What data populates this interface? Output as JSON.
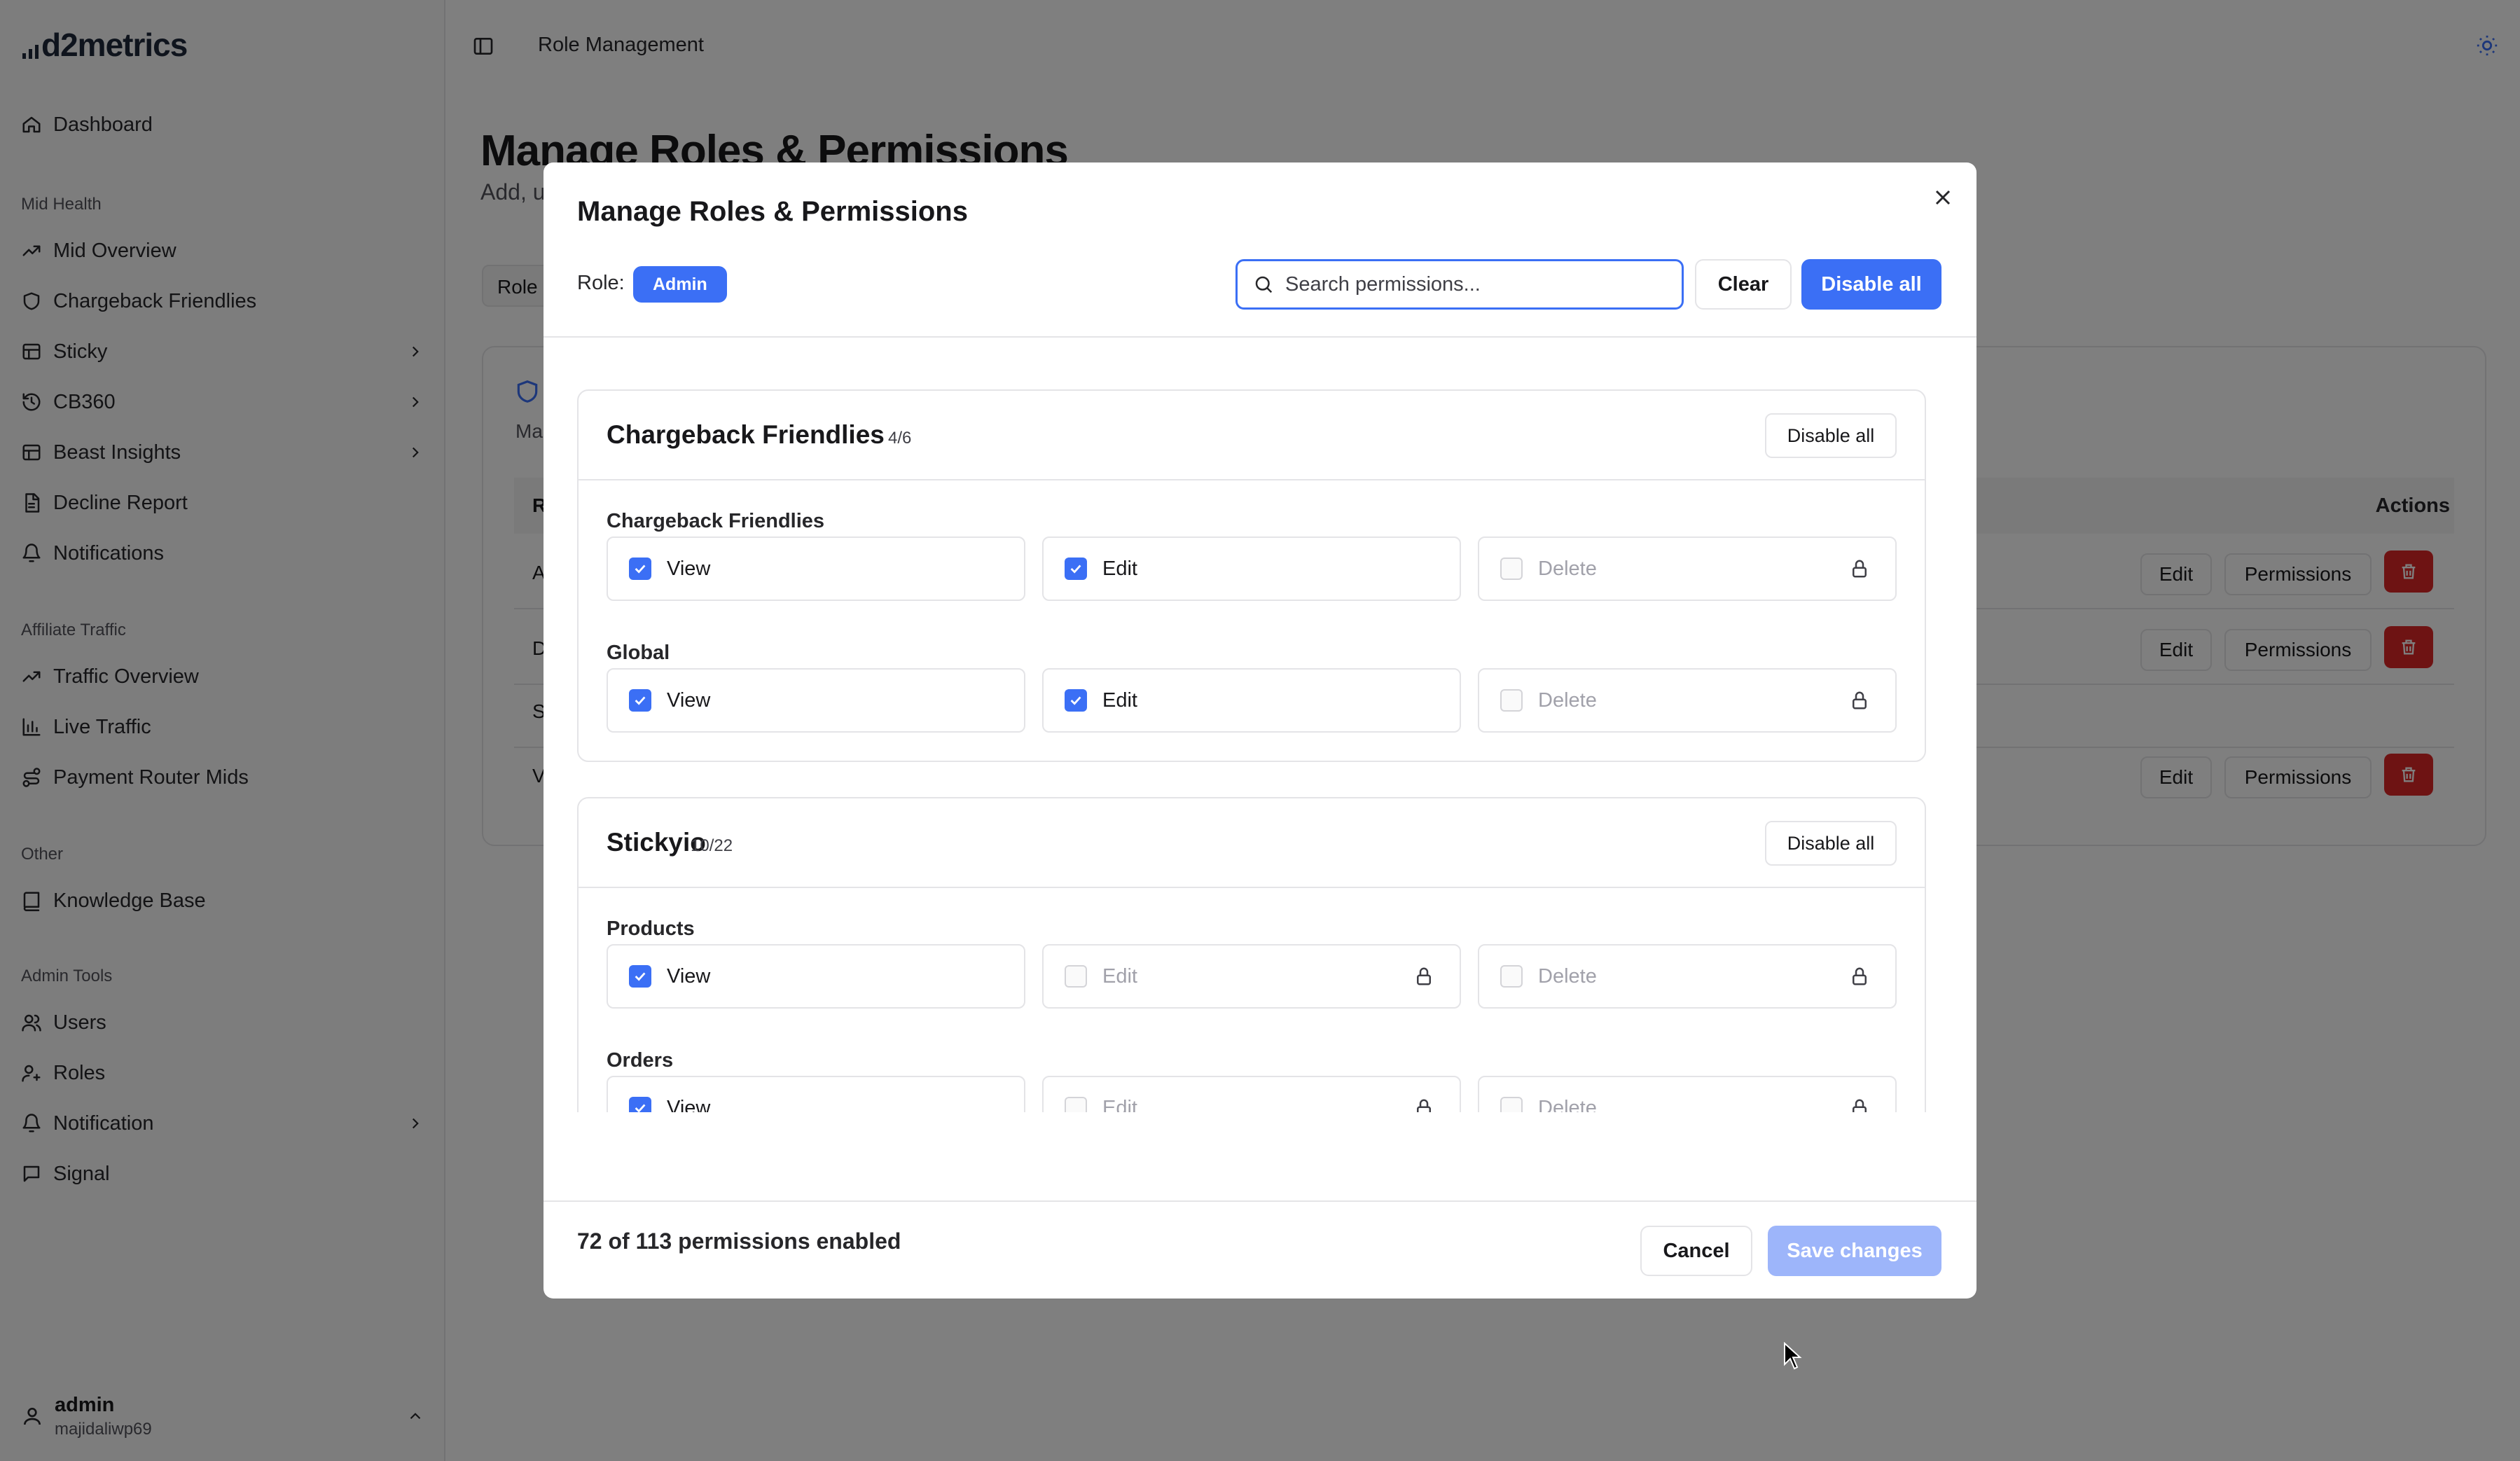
{
  "app": {
    "logo_text": "d2metrics",
    "page_header": "Role Management"
  },
  "sidebar": {
    "items_top": [
      {
        "label": "Dashboard",
        "icon": "home-icon"
      }
    ],
    "sections": [
      {
        "title": "Mid Health",
        "items": [
          {
            "label": "Mid Overview",
            "icon": "trend-icon"
          },
          {
            "label": "Chargeback Friendlies",
            "icon": "shield-icon"
          },
          {
            "label": "Sticky",
            "icon": "table-icon",
            "has_chevron": true
          },
          {
            "label": "CB360",
            "icon": "history-icon",
            "has_chevron": true
          },
          {
            "label": "Beast Insights",
            "icon": "table-icon",
            "has_chevron": true
          },
          {
            "label": "Decline Report",
            "icon": "file-icon"
          },
          {
            "label": "Notifications",
            "icon": "bell-icon"
          }
        ]
      },
      {
        "title": "Affiliate Traffic",
        "items": [
          {
            "label": "Traffic Overview",
            "icon": "trend-icon"
          },
          {
            "label": "Live Traffic",
            "icon": "bar-chart-icon"
          },
          {
            "label": "Payment Router Mids",
            "icon": "route-icon"
          }
        ]
      },
      {
        "title": "Other",
        "items": [
          {
            "label": "Knowledge Base",
            "icon": "book-icon"
          }
        ]
      },
      {
        "title": "Admin Tools",
        "items": [
          {
            "label": "Users",
            "icon": "users-icon"
          },
          {
            "label": "Roles",
            "icon": "user-key-icon"
          },
          {
            "label": "Notification",
            "icon": "bell-icon",
            "has_chevron": true
          },
          {
            "label": "Signal",
            "icon": "message-icon"
          }
        ]
      }
    ],
    "user": {
      "name": "admin",
      "handle": "majidaliwp69"
    }
  },
  "background_page": {
    "title": "Manage Roles & Permissions",
    "subtitle": "Add, u",
    "tab_label": "Role",
    "card_subtitle": "Ma",
    "table_header_first": "R",
    "actions_label": "Actions",
    "row_letters": [
      "A",
      "D",
      "S",
      "V"
    ],
    "edit_label": "Edit",
    "permissions_label": "Permissions"
  },
  "modal": {
    "title": "Manage Roles & Permissions",
    "role_label": "Role:",
    "role_value": "Admin",
    "search_placeholder": "Search permissions...",
    "clear_label": "Clear",
    "disable_all_label": "Disable all",
    "groups": [
      {
        "title": "Chargeback Friendlies",
        "count": "4/6",
        "disable_label": "Disable all",
        "resources": [
          {
            "name": "Chargeback Friendlies",
            "perms": [
              {
                "label": "View",
                "checked": true,
                "locked": false
              },
              {
                "label": "Edit",
                "checked": true,
                "locked": false
              },
              {
                "label": "Delete",
                "checked": false,
                "locked": true
              }
            ]
          },
          {
            "name": "Global",
            "perms": [
              {
                "label": "View",
                "checked": true,
                "locked": false
              },
              {
                "label": "Edit",
                "checked": true,
                "locked": false
              },
              {
                "label": "Delete",
                "checked": false,
                "locked": true
              }
            ]
          }
        ]
      },
      {
        "title": "Stickyio",
        "count": "10/22",
        "disable_label": "Disable all",
        "resources": [
          {
            "name": "Products",
            "perms": [
              {
                "label": "View",
                "checked": true,
                "locked": false
              },
              {
                "label": "Edit",
                "checked": false,
                "locked": true
              },
              {
                "label": "Delete",
                "checked": false,
                "locked": true
              }
            ]
          },
          {
            "name": "Orders",
            "perms": [
              {
                "label": "View",
                "checked": true,
                "locked": false
              },
              {
                "label": "Edit",
                "checked": false,
                "locked": true
              },
              {
                "label": "Delete",
                "checked": false,
                "locked": true
              }
            ]
          }
        ]
      }
    ],
    "footer_status": "72 of 113 permissions enabled",
    "cancel_label": "Cancel",
    "save_label": "Save changes"
  },
  "colors": {
    "accent": "#3b6ff5",
    "danger": "#dc2626",
    "save_disabled": "#9db5fa"
  }
}
